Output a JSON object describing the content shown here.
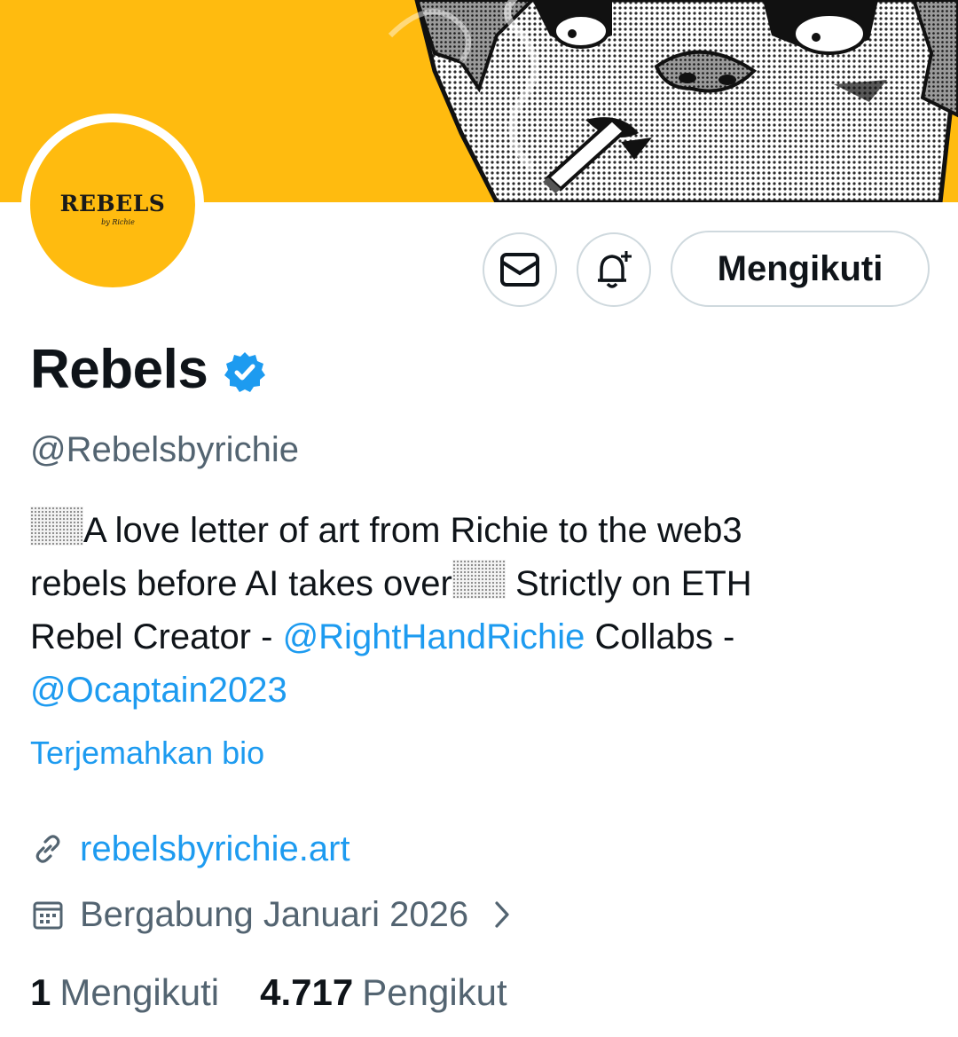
{
  "profile": {
    "avatar_text": "REBELS",
    "avatar_signature": "by Richie",
    "name": "Rebels",
    "handle": "@Rebelsbyrichie",
    "follow_button": "Mengikuti",
    "bio": {
      "line1_text": "A love letter of art from Richie to the web3",
      "line2_text": "rebels before AI takes over",
      "line2_tail": " Strictly on ETH",
      "line3_text": "Rebel Creator - ",
      "mention1": "@RightHandRichie",
      "line3_tail": " Collabs -",
      "mention2": "@Ocaptain2023"
    },
    "translate_bio": "Terjemahkan bio",
    "website": "rebelsbyrichie.art",
    "joined": "Bergabung Januari 2026",
    "following_count": "1",
    "following_label": "Mengikuti",
    "followers_count": "4.717",
    "followers_label": "Pengikut"
  },
  "icons": {
    "dm": "envelope-icon",
    "notify": "bell-plus-icon",
    "verified": "verified-badge-icon",
    "link": "link-icon",
    "calendar": "calendar-icon",
    "chevron": "chevron-right-icon"
  },
  "colors": {
    "banner": "#ffbb0f",
    "accent": "#1d9bf0",
    "secondary_text": "#536471",
    "primary_text": "#0f1419"
  }
}
